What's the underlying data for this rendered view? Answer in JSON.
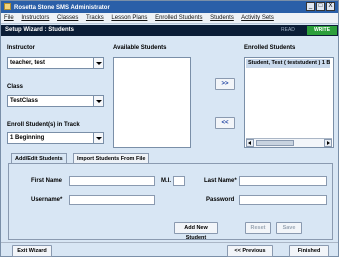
{
  "window": {
    "title": "Rosetta Stone SMS Administrator",
    "controls": {
      "minimize": "_",
      "maximize": "□",
      "close": "X"
    }
  },
  "menu": [
    "File",
    "Instructors",
    "Classes",
    "Tracks",
    "Lesson Plans",
    "Enrolled Students",
    "Students",
    "Activity Sets"
  ],
  "wizard": {
    "title": "Setup Wizard : Students",
    "read_label": "READ",
    "write_label": "WRITE",
    "write_color": "#2c9f3b"
  },
  "left": {
    "instructor_label": "Instructor",
    "instructor_value": "teacher, test",
    "class_label": "Class",
    "class_value": "TestClass",
    "track_label": "Enroll Student(s) in Track",
    "track_value": "1 Beginning"
  },
  "available": {
    "label": "Available Students",
    "items": []
  },
  "moves": {
    "add_label": ">>",
    "remove_label": "<<"
  },
  "enrolled": {
    "label": "Enrolled Students",
    "items": [
      "Student, Test ( teststudent ) 1 B"
    ]
  },
  "tabs": {
    "add_edit": "Add/Edit Students",
    "import": "Import Students From File"
  },
  "form": {
    "first_name_label": "First Name",
    "mi_label": "M.I.",
    "last_name_label": "Last Name*",
    "username_label": "Username*",
    "password_label": "Password",
    "first_name_value": "",
    "mi_value": "",
    "last_name_value": "",
    "username_value": "",
    "password_value": ""
  },
  "actions": {
    "add_new_student": "Add New Student",
    "reset": "Reset",
    "save": "Save"
  },
  "footer": {
    "exit": "Exit Wizard",
    "previous": "<< Previous",
    "finished": "Finished"
  }
}
